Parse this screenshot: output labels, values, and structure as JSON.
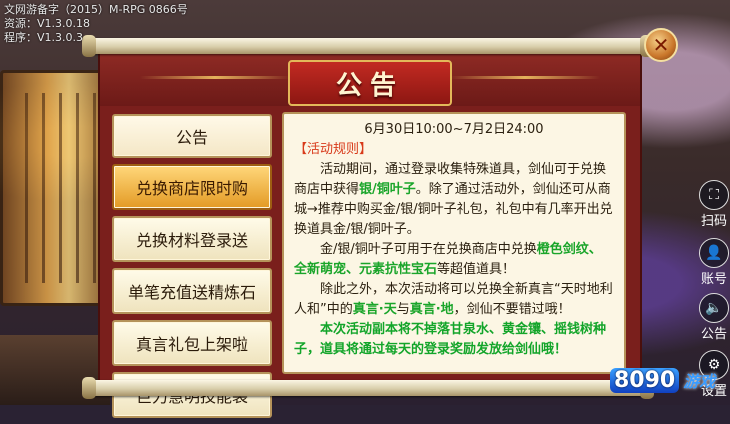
{
  "watermark": {
    "line1": "文网游备字（2015）M-RPG 0866号",
    "line2": "资源：V1.3.0.18",
    "line3": "程序：V1.3.0.3"
  },
  "dialog": {
    "title": "公告",
    "close_icon": "✕"
  },
  "tabs": [
    {
      "label": "公告",
      "active": false
    },
    {
      "label": "兑换商店限时购",
      "active": true
    },
    {
      "label": "兑换材料登录送",
      "active": false
    },
    {
      "label": "单笔充值送精炼石",
      "active": false
    },
    {
      "label": "真言礼包上架啦",
      "active": false
    },
    {
      "label": "巨力慧明技能袋",
      "active": false
    }
  ],
  "content": {
    "date": "6月30日10:00~7月2日24:00",
    "rules_header": "【活动规则】",
    "p1_a": "活动期间，通过登录收集特殊道具，剑仙可于兑换商店中获得",
    "p1_b": "银/铜叶子",
    "p1_c": "。除了通过活动外，剑仙还可从商城→推荐中购买金/银/铜叶子礼包，礼包中有几率开出兑换道具金/银/铜叶子。",
    "p2_a": "金/银/铜叶子可用于在兑换商店中兑换",
    "p2_b": "橙色剑纹、全新萌宠、元素抗性宝石",
    "p2_c": "等超值道具！",
    "p3_a": "除此之外，本次活动将可以兑换全新真言“天时地利人和”中的",
    "p3_b": "真言·天",
    "p3_c": "与",
    "p3_d": "真言·地",
    "p3_e": "，剑仙不要错过哦！",
    "p4": "本次活动副本将不掉落甘泉水、黄金镶、摇钱树种子，道具将通过每天的登录奖励发放给剑仙哦！"
  },
  "side": {
    "scan_label": "扫码",
    "account_label": "账号",
    "notice_label": "公告",
    "settings_label": "设置"
  },
  "logo": {
    "num": "8090",
    "word": "游戏"
  },
  "colors": {
    "panel_red": "#7a1f1c",
    "active_tab": "#e39a25",
    "highlight_green": "#1aa52a",
    "rules_red": "#d83a1a"
  }
}
